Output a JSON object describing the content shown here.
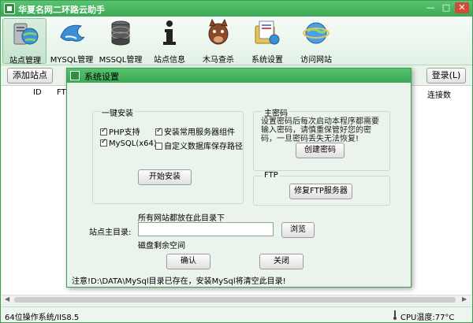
{
  "app": {
    "title": "华夏名网二环路云助手"
  },
  "window_buttons": {
    "minimize": "—",
    "maximize": "□",
    "close": "✕"
  },
  "toolbar": {
    "items": [
      {
        "label": "站点管理",
        "icon": "globe-computer-icon"
      },
      {
        "label": "MYSQL管理",
        "icon": "dolphin-icon"
      },
      {
        "label": "MSSQL管理",
        "icon": "database-icon"
      },
      {
        "label": "站点信息",
        "icon": "info-icon"
      },
      {
        "label": "木马查杀",
        "icon": "horse-icon"
      },
      {
        "label": "系统设置",
        "icon": "settings-folder-icon"
      },
      {
        "label": "访问网站",
        "icon": "ie-globe-icon"
      }
    ]
  },
  "sub_bar": {
    "add_site": "添加站点",
    "login": "登录(L)"
  },
  "table": {
    "columns": [
      "ID",
      "FTP",
      "连接数"
    ]
  },
  "status_bar": {
    "left": "64位操作系统/IIS8.5",
    "cpu_temp": "CPU温度:77°C"
  },
  "dialog": {
    "title": "系统设置",
    "one_click": {
      "title": "一键安装",
      "php": "PHP支持",
      "mysql": "MySQL(x64)",
      "common_components": "安装常用服务器组件",
      "custom_db_path": "自定义数据库保存路径",
      "start_install": "开始安装"
    },
    "master_password": {
      "title": "主密码",
      "description": "设置密码后每次启动本程序都需要输入密码，请慎重保管好您的密码，一旦密码丢失无法恢复!",
      "create_button": "创建密码"
    },
    "ftp": {
      "title": "FTP",
      "repair_button": "修复FTP服务器"
    },
    "site_root": {
      "hint": "所有网站都放在此目录下",
      "label": "站点主目录:",
      "value": "",
      "browse": "浏览",
      "disk_free": "磁盘剩余空间"
    },
    "ok": "确认",
    "close": "关闭",
    "note": "注意!D:\\DATA\\MySql目录已存在，安装MySql将清空此目录!"
  }
}
